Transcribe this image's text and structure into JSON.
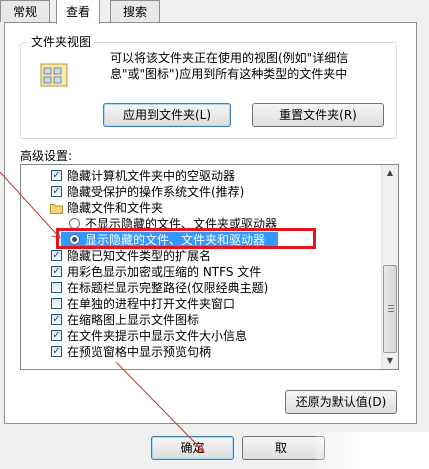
{
  "tabs": [
    {
      "label": "常规"
    },
    {
      "label": "查看"
    },
    {
      "label": "搜索"
    }
  ],
  "folder_view": {
    "title": "文件夹视图",
    "description": "可以将该文件夹正在使用的视图(例如\"详细信息\"或\"图标\")应用到所有这种类型的文件夹中",
    "apply_button": "应用到文件夹(L)",
    "reset_button": "重置文件夹(R)"
  },
  "advanced": {
    "label": "高级设置:",
    "items": [
      {
        "kind": "checkbox",
        "checked": true,
        "label": "隐藏计算机文件夹中的空驱动器"
      },
      {
        "kind": "checkbox",
        "checked": true,
        "label": "隐藏受保护的操作系统文件(推荐)"
      },
      {
        "kind": "folder",
        "label": "隐藏文件和文件夹"
      },
      {
        "kind": "radio",
        "checked": false,
        "label": "不显示隐藏的文件、文件夹或驱动器"
      },
      {
        "kind": "radio",
        "checked": true,
        "label": "显示隐藏的文件、文件夹和驱动器"
      },
      {
        "kind": "checkbox",
        "checked": true,
        "label": "隐藏已知文件类型的扩展名"
      },
      {
        "kind": "checkbox",
        "checked": true,
        "label": "用彩色显示加密或压缩的 NTFS 文件"
      },
      {
        "kind": "checkbox",
        "checked": false,
        "label": "在标题栏显示完整路径(仅限经典主题)"
      },
      {
        "kind": "checkbox",
        "checked": false,
        "label": "在单独的进程中打开文件夹窗口"
      },
      {
        "kind": "checkbox",
        "checked": true,
        "label": "在缩略图上显示文件图标"
      },
      {
        "kind": "checkbox",
        "checked": true,
        "label": "在文件夹提示中显示文件大小信息"
      },
      {
        "kind": "checkbox",
        "checked": true,
        "label": "在预览窗格中显示预览句柄"
      }
    ]
  },
  "restore_button": "还原为默认值(D)",
  "ok_button": "确定",
  "cancel_button": "取"
}
